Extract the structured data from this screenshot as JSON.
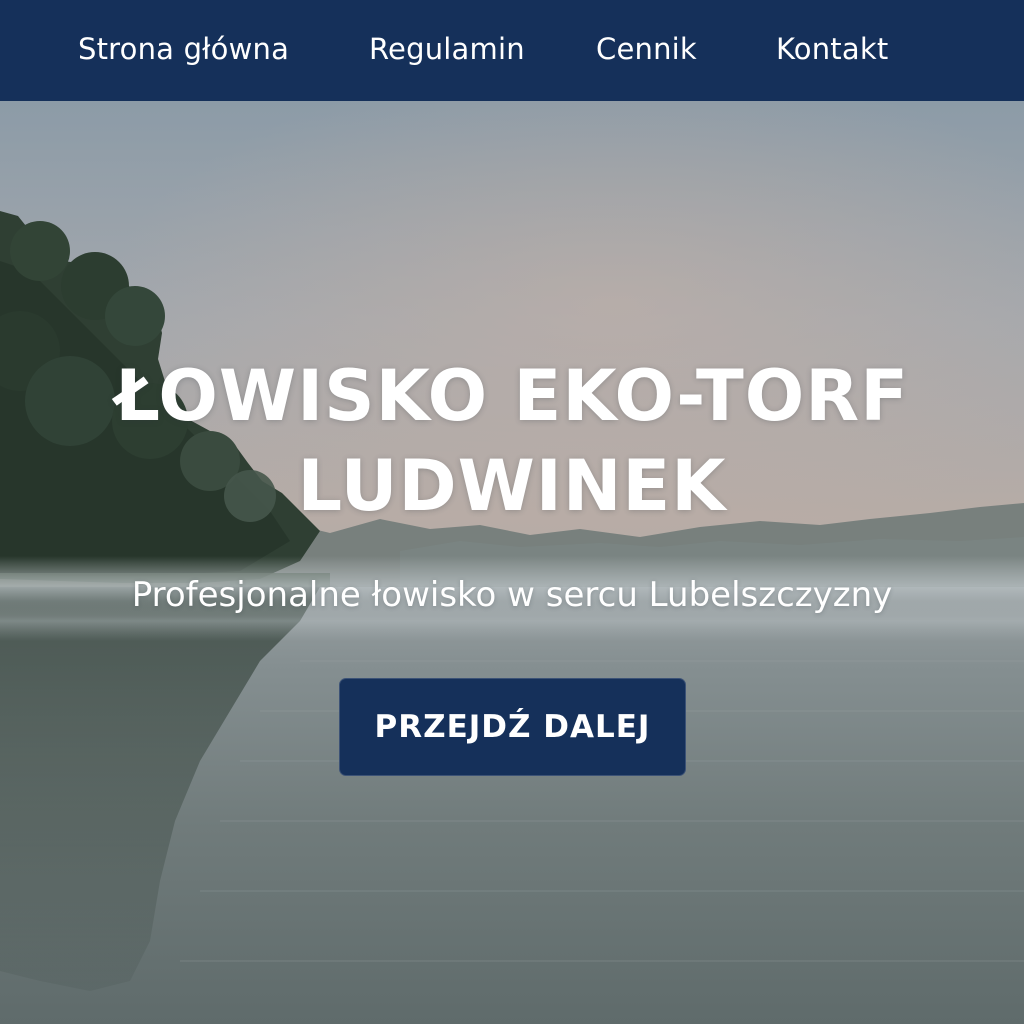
{
  "nav": {
    "items": [
      {
        "label": "Strona główna"
      },
      {
        "label": "Regulamin"
      },
      {
        "label": "Cennik"
      },
      {
        "label": "Kontakt"
      }
    ]
  },
  "hero": {
    "title_line1": "ŁOWISKO EKO-TORF",
    "title_line2": "LUDWINEK",
    "subtitle": "Profesjonalne łowisko w sercu Lubelszczyzny",
    "cta_label": "PRZEJDŹ DALEJ"
  },
  "colors": {
    "nav_background": "#15305a",
    "button_background": "#15305a",
    "text": "#ffffff",
    "sky_top": "#8c9aa6",
    "sky_horizon": "#b6aaa3",
    "water": "#6f7a7a"
  }
}
